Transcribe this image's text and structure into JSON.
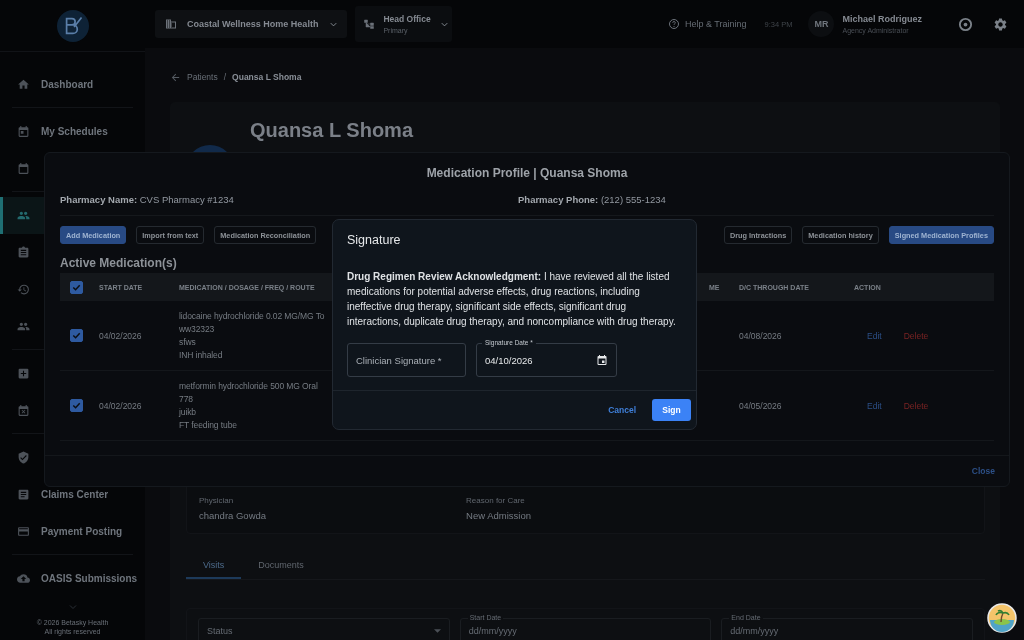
{
  "topbar": {
    "agency": "Coastal Wellness Home Health",
    "office": {
      "name": "Head Office",
      "sub": "Primary"
    },
    "help": "Help & Training",
    "time": "9:34 PM",
    "user": {
      "initials": "MR",
      "name": "Michael Rodriguez",
      "role": "Agency Administrator"
    }
  },
  "sidebar": {
    "sections": [
      [
        {
          "label": "Dashboard",
          "selected": false
        }
      ],
      [
        {
          "label": "My Schedules",
          "selected": false
        },
        {
          "selected": false
        }
      ],
      [
        {
          "selected": true
        },
        {
          "selected": false
        },
        {
          "selected": false
        },
        {
          "selected": false
        }
      ],
      [
        {
          "selected": false
        },
        {
          "selected": false
        }
      ],
      [
        {
          "selected": false
        },
        {
          "label": "Claims Center",
          "selected": false
        },
        {
          "label": "Payment Posting",
          "selected": false
        }
      ],
      [
        {
          "label": "OASIS Submissions",
          "selected": false
        }
      ]
    ],
    "footer": [
      "© 2026 Betasky Health",
      "All rights reserved"
    ]
  },
  "breadcrumb": {
    "parent": "Patients",
    "separator": "/",
    "current": "Quansa L Shoma"
  },
  "patient": {
    "name": "Quansa L Shoma"
  },
  "details": [
    {
      "label": "Physician",
      "value": "chandra Gowda"
    },
    {
      "label": "Reason for Care",
      "value": "New Admission"
    }
  ],
  "tabs": [
    {
      "label": "Visits",
      "selected": true
    },
    {
      "label": "Documents",
      "selected": false
    }
  ],
  "filters": [
    {
      "kind": "select",
      "placeholder": "Status"
    },
    {
      "kind": "date",
      "label": "Start Date",
      "placeholder": "dd/mm/yyyy"
    },
    {
      "kind": "date",
      "label": "End Date",
      "placeholder": "dd/mm/yyyy"
    }
  ],
  "medication_profile": {
    "title": "Medication Profile | Quansa Shoma",
    "pharmacy": [
      {
        "label": "Pharmacy Name:",
        "value": "CVS Pharmacy #1234"
      },
      {
        "label": "Pharmacy Phone:",
        "value": "(212) 555-1234"
      }
    ],
    "left_actions": [
      {
        "label": "Add Medication",
        "primary": true
      },
      {
        "label": "Import from text",
        "primary": false
      },
      {
        "label": "Medication Reconciliation",
        "primary": false
      }
    ],
    "right_actions": [
      {
        "label": "Drug Intractions",
        "primary": false
      },
      {
        "label": "Medication history",
        "primary": false
      },
      {
        "label": "Signed Medication Profiles",
        "primary": true
      }
    ],
    "section_title": "Active Medication(s)",
    "table": {
      "all_checked": true,
      "columns": [
        "START DATE",
        "MEDICATION / DOSAGE / FREQ / ROUTE",
        "ME",
        "D/C THROUGH DATE",
        "ACTION"
      ],
      "rows": [
        {
          "checked": true,
          "start_date": "04/02/2026",
          "medication": [
            "lidocaine hydrochloride 0.02 MG/MG To",
            "ww32323",
            "sfws",
            "INH inhaled"
          ],
          "dc_date": "04/08/2026",
          "edit": "Edit",
          "delete": "Delete"
        },
        {
          "checked": true,
          "start_date": "04/02/2026",
          "medication": [
            "metformin hydrochloride 500 MG Oral",
            "778",
            "juikb",
            "FT feeding tube"
          ],
          "dc_date": "04/05/2026",
          "edit": "Edit",
          "delete": "Delete"
        }
      ]
    },
    "close": "Close"
  },
  "signature_dialog": {
    "title": "Signature",
    "text": "**Drug Regimen Review Acknowledgment:** I have reviewed all the listed medications for potential adverse effects, drug reactions, including ineffective drug therapy, significant side effects, significant drug interactions, duplicate drug therapy, and noncompliance with drug therapy.",
    "signature_field": {
      "placeholder": "Clinician Signature *"
    },
    "date_field": {
      "label": "Signature Date *",
      "value": "04/10/2026"
    },
    "cancel": "Cancel",
    "sign": "Sign"
  }
}
